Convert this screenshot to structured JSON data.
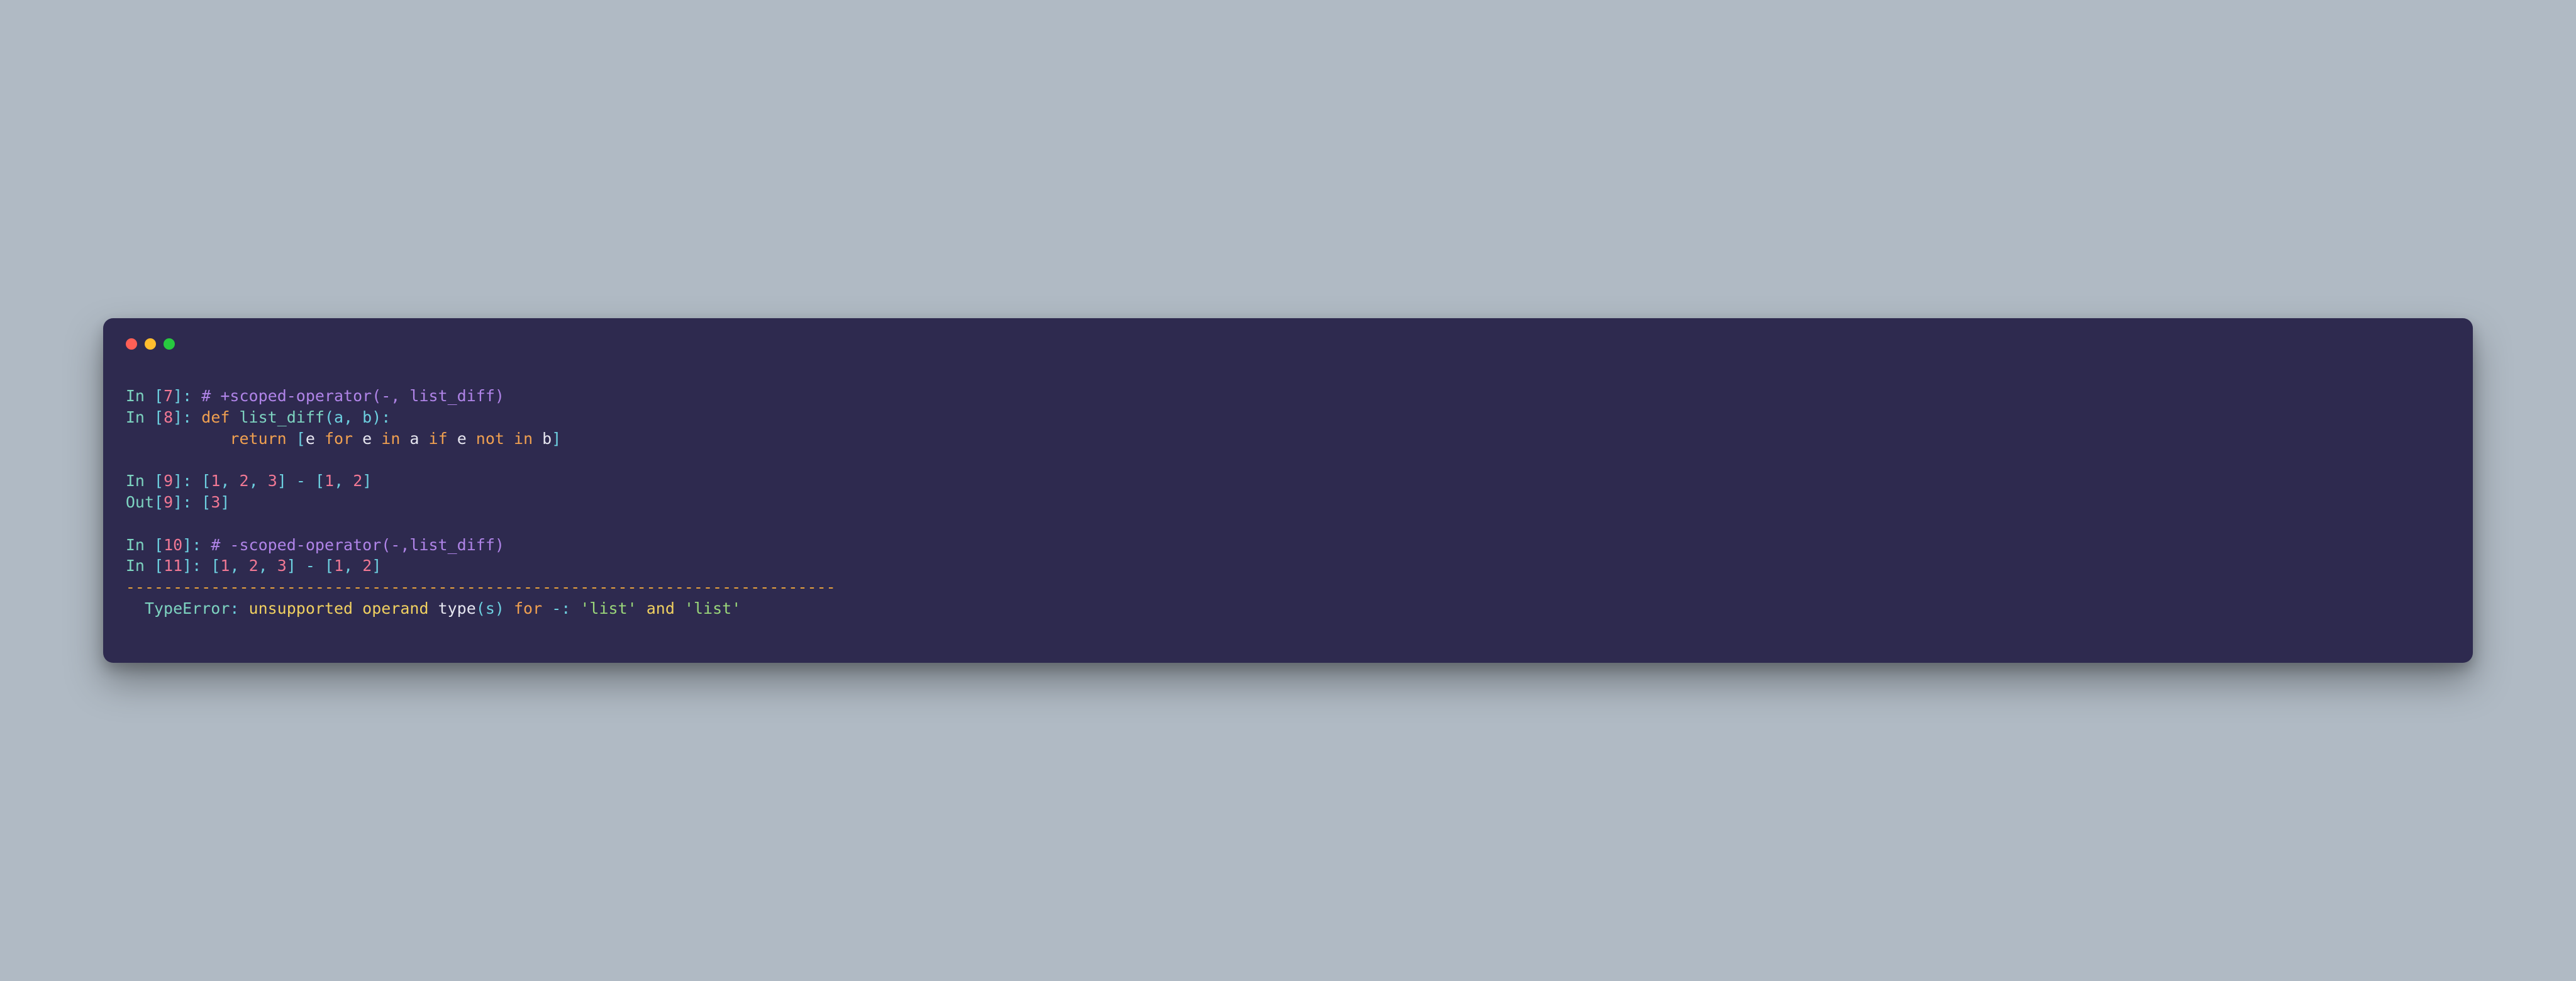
{
  "colors": {
    "close": "#ff5f56",
    "min": "#ffbd2e",
    "max": "#27c93f",
    "bg": "#2e2a4f"
  },
  "prompts": {
    "in": "In ",
    "out": "Out"
  },
  "lines": {
    "l7_num": "7",
    "l7_comment": "# +scoped-operator(-, list_diff)",
    "l8_num": "8",
    "l8_def": "def",
    "l8_name": "list_diff",
    "l8_params": "(a, b):",
    "l8b_indent": "           ",
    "l8b_return": "return",
    "l8b_open": " [",
    "l8b_e1": "e ",
    "l8b_for": "for",
    "l8b_e2": " e ",
    "l8b_in1": "in",
    "l8b_a": " a ",
    "l8b_if": "if",
    "l8b_e3": " e ",
    "l8b_not": "not",
    "l8b_sp": " ",
    "l8b_in2": "in",
    "l8b_b": " b",
    "l8b_close": "]",
    "l9_num": "9",
    "l9_expr_open": "[",
    "l9_n1": "1",
    "l9_c1": ", ",
    "l9_n2": "2",
    "l9_c2": ", ",
    "l9_n3": "3",
    "l9_close1": "] ",
    "l9_minus": "-",
    "l9_open2": " [",
    "l9_n4": "1",
    "l9_c3": ", ",
    "l9_n5": "2",
    "l9_close2": "]",
    "out9_num": "9",
    "out9_open": "[",
    "out9_val": "3",
    "out9_close": "]",
    "l10_num": "10",
    "l10_comment": "# -scoped-operator(-,list_diff)",
    "l11_num": "11",
    "l11_open1": "[",
    "l11_n1": "1",
    "l11_c1": ", ",
    "l11_n2": "2",
    "l11_c2": ", ",
    "l11_n3": "3",
    "l11_close1": "] ",
    "l11_minus": "-",
    "l11_open2": " [",
    "l11_n4": "1",
    "l11_c3": ", ",
    "l11_n5": "2",
    "l11_close2": "]",
    "sep": "---------------------------------------------------------------------------",
    "err_pad": "  ",
    "err_name": "TypeError",
    "err_colon": ": ",
    "err_msg1": "unsupported operand ",
    "err_type": "type",
    "err_paren": "(s) ",
    "err_for": "for",
    "err_minus": " -: ",
    "err_s1": "'list'",
    "err_and": " and ",
    "err_s2": "'list'"
  }
}
